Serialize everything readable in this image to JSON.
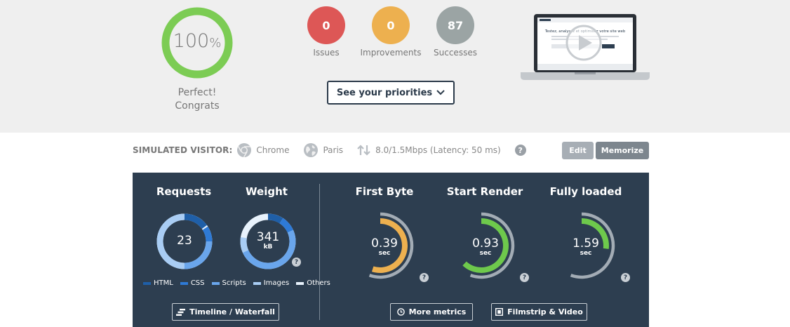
{
  "score": {
    "value": "100",
    "unit": "%",
    "message_line1": "Perfect!",
    "message_line2": "Congrats",
    "ring_color": "#7ccc54",
    "fraction": 1.0
  },
  "counters": [
    {
      "value": "0",
      "label": "Issues",
      "color": "#dd5756"
    },
    {
      "value": "0",
      "label": "Improvements",
      "color": "#edb04f"
    },
    {
      "value": "87",
      "label": "Successes",
      "color": "#9ba4a4"
    }
  ],
  "priorities": {
    "label": "See your priorities",
    "icon": "chevron-down-icon"
  },
  "preview": {
    "heading": "Testez, analysez et optimisez votre site web",
    "icon": "play-icon"
  },
  "visitor": {
    "label": "SIMULATED VISITOR:",
    "browser": "Chrome",
    "location": "Paris",
    "connection": "8.0/1.5Mbps (Latency: 50 ms)",
    "help": "?"
  },
  "actions": {
    "edit": "Edit",
    "memorize": "Memorize"
  },
  "panel": {
    "requests": {
      "title": "Requests",
      "value": "23"
    },
    "weight": {
      "title": "Weight",
      "value": "341",
      "unit": "kB",
      "help": "?"
    },
    "legend": [
      {
        "label": "HTML",
        "color": "#1f5fa8"
      },
      {
        "label": "CSS",
        "color": "#2e7ad6"
      },
      {
        "label": "Scripts",
        "color": "#6aa6ec"
      },
      {
        "label": "Images",
        "color": "#a9cdf4"
      },
      {
        "label": "Others",
        "color": "#e8f2fc"
      }
    ],
    "first_byte": {
      "title": "First Byte",
      "value": "0.39",
      "unit": "sec",
      "color": "#edb04f",
      "fraction": 0.55,
      "help": "?"
    },
    "start_render": {
      "title": "Start Render",
      "value": "0.93",
      "unit": "sec",
      "color": "#6ec94c",
      "fraction": 0.62,
      "help": "?"
    },
    "fully_loaded": {
      "title": "Fully loaded",
      "value": "1.59",
      "unit": "sec",
      "color": "#6ec94c",
      "fraction": 0.27,
      "help": "?"
    },
    "timeline_btn": "Timeline / Waterfall",
    "metrics_btn": "More metrics",
    "filmstrip_btn": "Filmstrip & Video"
  }
}
